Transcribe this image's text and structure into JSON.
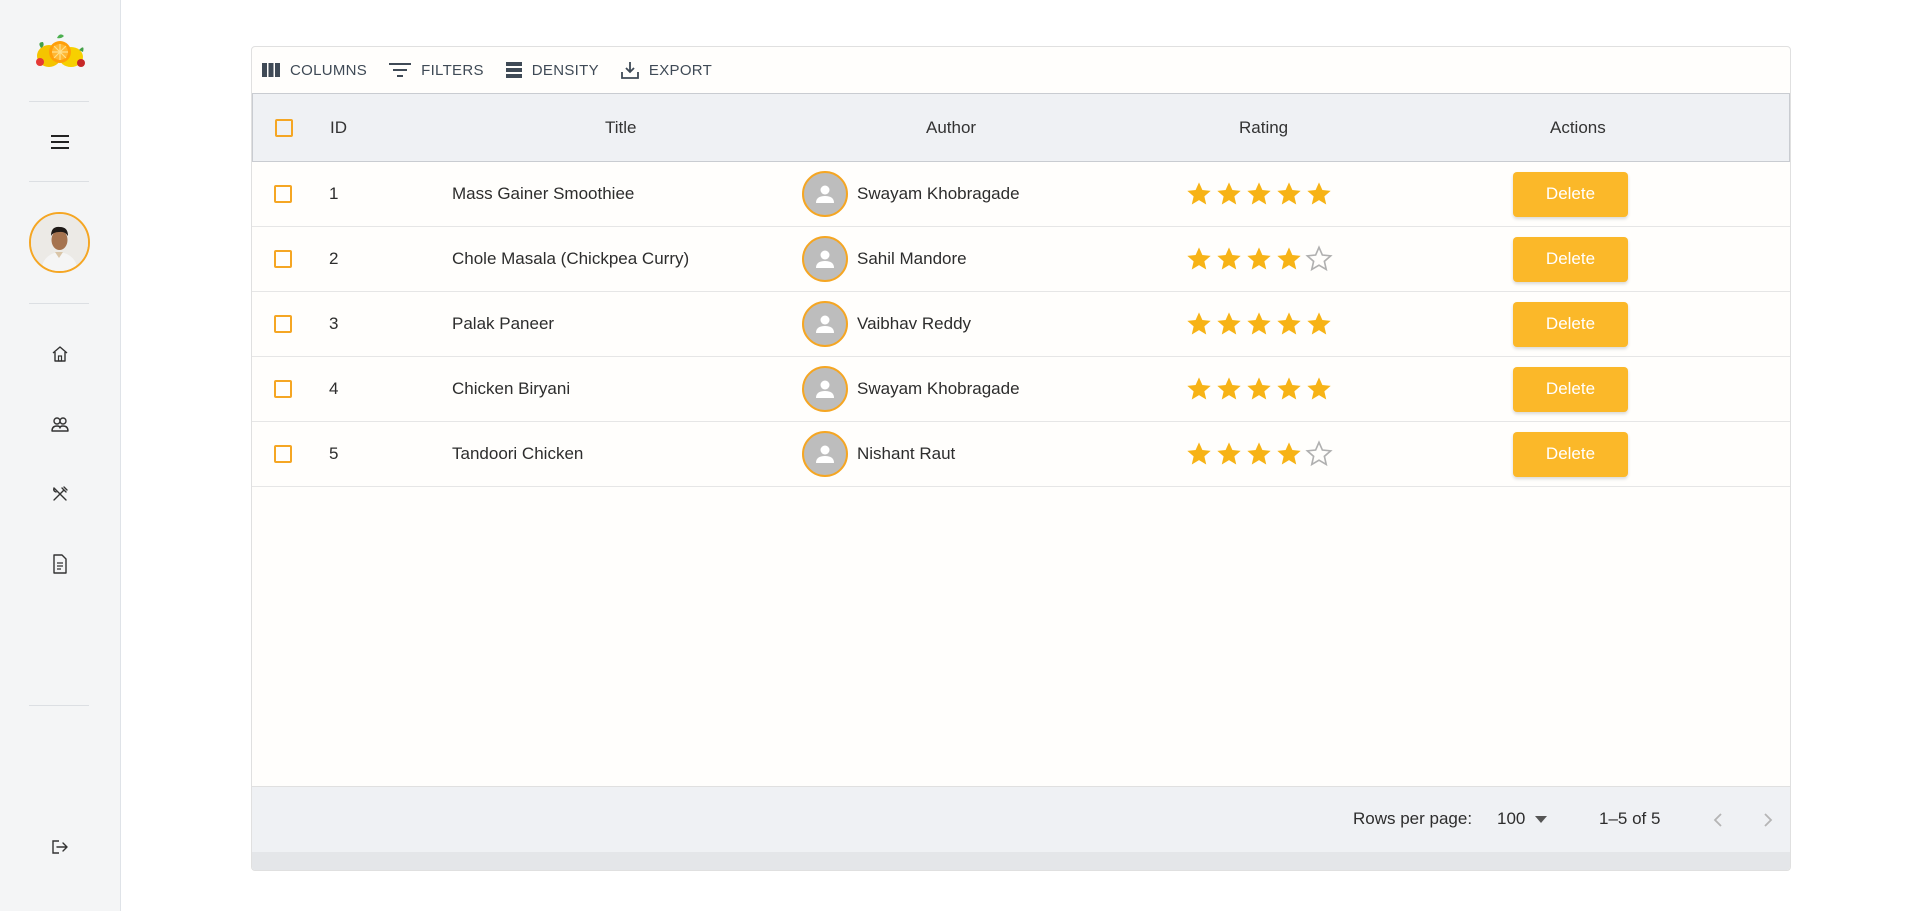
{
  "sidebar": {
    "nav": [
      {
        "icon": "home-icon"
      },
      {
        "icon": "users-icon"
      },
      {
        "icon": "utensils-icon"
      },
      {
        "icon": "document-icon"
      }
    ],
    "menu_icon": "hamburger-menu-icon",
    "logout_icon": "logout-icon"
  },
  "toolbar": {
    "columns": "COLUMNS",
    "filters": "FILTERS",
    "density": "DENSITY",
    "export": "EXPORT"
  },
  "table": {
    "headers": {
      "id": "ID",
      "title": "Title",
      "author": "Author",
      "rating": "Rating",
      "actions": "Actions"
    },
    "rows": [
      {
        "id": "1",
        "title": "Mass Gainer Smoothiee",
        "author": "Swayam Khobragade",
        "rating": 5,
        "action": "Delete"
      },
      {
        "id": "2",
        "title": "Chole Masala (Chickpea Curry)",
        "author": "Sahil Mandore",
        "rating": 4,
        "action": "Delete"
      },
      {
        "id": "3",
        "title": "Palak Paneer",
        "author": "Vaibhav Reddy",
        "rating": 5,
        "action": "Delete"
      },
      {
        "id": "4",
        "title": "Chicken Biryani",
        "author": "Swayam Khobragade",
        "rating": 5,
        "action": "Delete"
      },
      {
        "id": "5",
        "title": "Tandoori Chicken",
        "author": "Nishant Raut",
        "rating": 4,
        "action": "Delete"
      }
    ],
    "rating_max": 5
  },
  "footer": {
    "rows_per_page_label": "Rows per page:",
    "rows_per_page_value": "100",
    "range": "1–5 of 5"
  },
  "colors": {
    "accent": "#f5a623",
    "button": "#fbb829",
    "star_filled": "#f7b316",
    "star_empty": "#b0b0b0"
  }
}
